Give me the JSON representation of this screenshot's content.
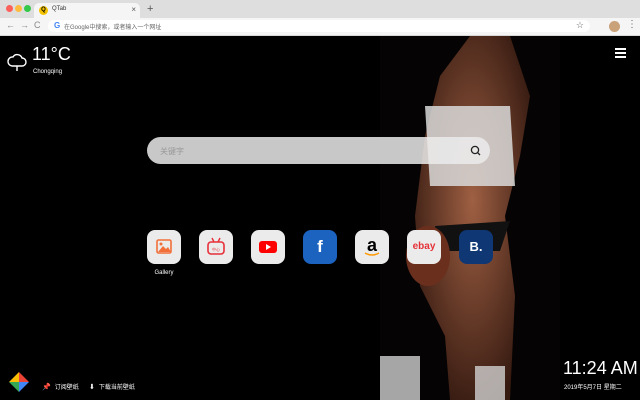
{
  "browser": {
    "tab_title": "QTab",
    "tab_favicon": "Q",
    "tab_close": "×",
    "new_tab": "+",
    "address_icon": "G",
    "address_placeholder": "在Google中搜索，或者输入一个网址",
    "nav_back": "←",
    "nav_forward": "→",
    "nav_reload": "C",
    "bookmark_star": "☆",
    "menu": "⋮"
  },
  "weather": {
    "temperature": "11°C",
    "city": "Chongqing",
    "icon": "cloud-icon"
  },
  "search": {
    "placeholder": "关键字"
  },
  "shortcuts": [
    {
      "name": "gallery",
      "label": "Gallery",
      "color": "#f26f3a"
    },
    {
      "name": "bilibili",
      "label": "",
      "text": "中心",
      "color": "#e8303a"
    },
    {
      "name": "youtube",
      "label": "",
      "color": "#ff0000"
    },
    {
      "name": "facebook",
      "label": "",
      "text": "f",
      "color": "#1b63bf"
    },
    {
      "name": "amazon",
      "label": "",
      "text": "a",
      "color": "#000000"
    },
    {
      "name": "ebay",
      "label": "",
      "text": "ebay",
      "color": "#e53238"
    },
    {
      "name": "booking",
      "label": "",
      "text": "B.",
      "color": "#0e3774"
    }
  ],
  "bottom": {
    "wallpaper_label": "订阅壁纸",
    "wallpaper_icon": "📌",
    "download_label": "下载当前壁纸",
    "download_icon": "⬇"
  },
  "clock": {
    "time": "11:24 AM",
    "date": "2019年5月7日 星期二"
  },
  "colors": {
    "background": "#000000",
    "search_bg": "#ebebeb",
    "text": "#ffffff"
  }
}
